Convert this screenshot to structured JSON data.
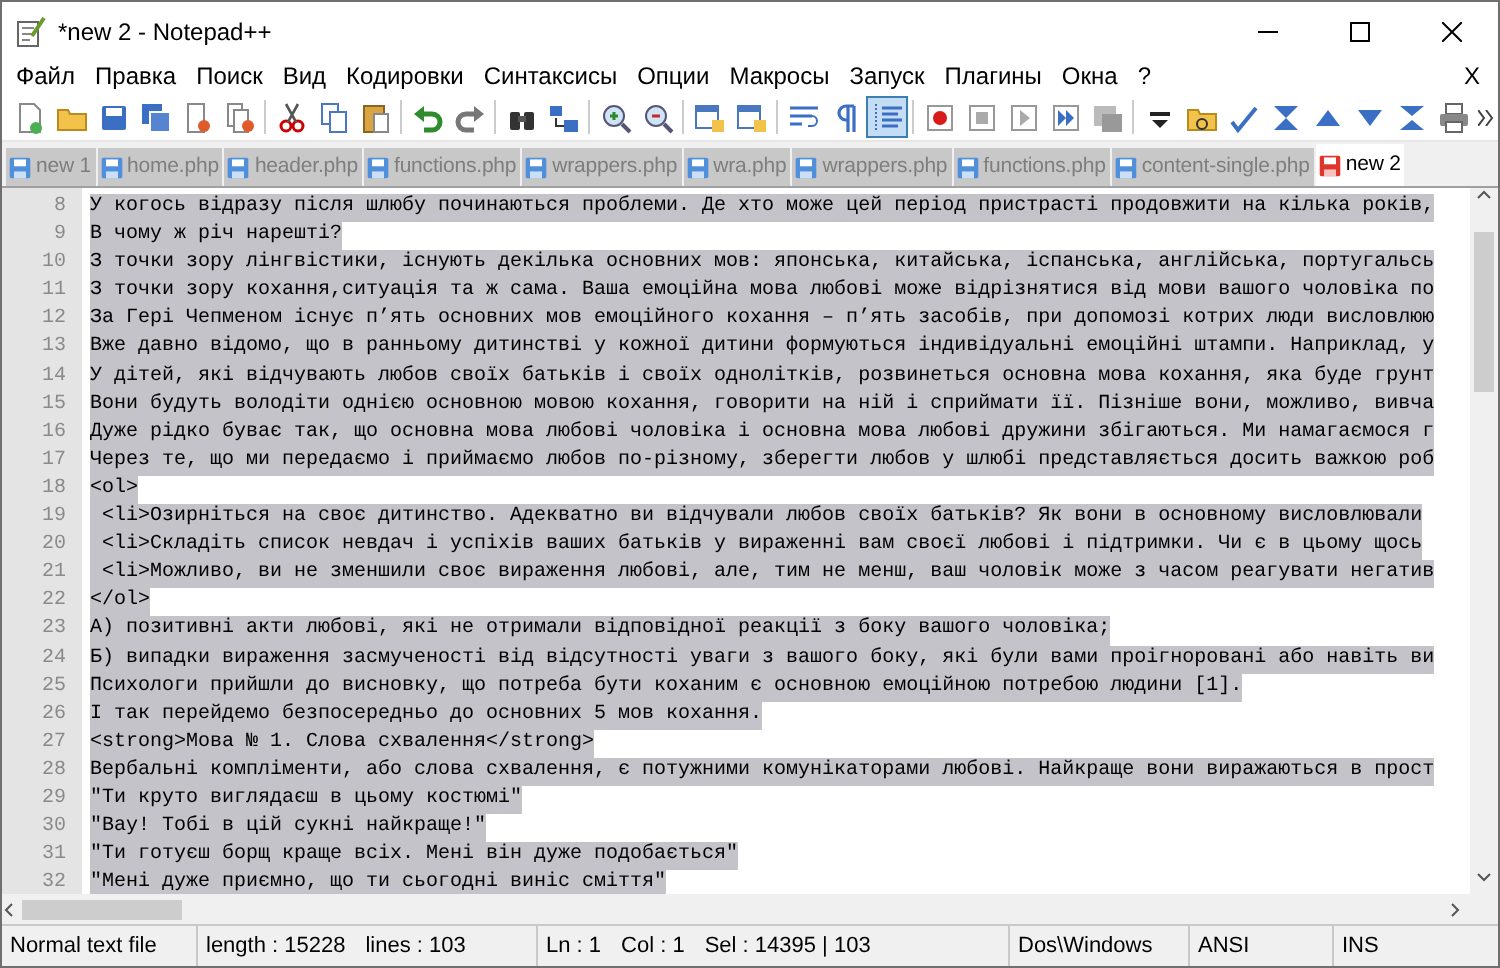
{
  "window": {
    "title": "*new 2 - Notepad++"
  },
  "menu": [
    {
      "label": "Файл"
    },
    {
      "label": "Правка"
    },
    {
      "label": "Поиск"
    },
    {
      "label": "Вид"
    },
    {
      "label": "Кодировки"
    },
    {
      "label": "Синтаксисы"
    },
    {
      "label": "Опции"
    },
    {
      "label": "Макросы"
    },
    {
      "label": "Запуск"
    },
    {
      "label": "Плагины"
    },
    {
      "label": "Окна"
    },
    {
      "label": "?"
    }
  ],
  "menu_close": "X",
  "toolbar": [
    {
      "pressed": false
    },
    {
      "pressed": false
    },
    {
      "pressed": false
    },
    {
      "pressed": false
    },
    {
      "pressed": false
    },
    {
      "pressed": false
    },
    {
      "pressed": false
    },
    {
      "pressed": false
    },
    {
      "pressed": false
    },
    {
      "pressed": false
    },
    {
      "pressed": false
    },
    {
      "pressed": false
    },
    {
      "pressed": false
    },
    {
      "pressed": false
    },
    {
      "pressed": false
    },
    {
      "pressed": false
    },
    {
      "pressed": false
    },
    {
      "pressed": false
    },
    {
      "pressed": false
    },
    {
      "pressed": true
    },
    {
      "pressed": false
    },
    {
      "pressed": false
    },
    {
      "pressed": false
    },
    {
      "pressed": false
    },
    {
      "pressed": false
    },
    {
      "pressed": false
    },
    {
      "pressed": false
    },
    {
      "pressed": false
    },
    {
      "pressed": false
    },
    {
      "pressed": false
    },
    {
      "pressed": false
    },
    {
      "pressed": false
    },
    {
      "pressed": false
    }
  ],
  "tabs": [
    {
      "label": "new 1",
      "selected": false,
      "modified": false
    },
    {
      "label": "home.php",
      "selected": false,
      "modified": false
    },
    {
      "label": "header.php",
      "selected": false,
      "modified": false
    },
    {
      "label": "functions.php",
      "selected": false,
      "modified": false
    },
    {
      "label": "wrappers.php",
      "selected": false,
      "modified": false
    },
    {
      "label": "wra.php",
      "selected": false,
      "modified": false
    },
    {
      "label": "wrappers.php",
      "selected": false,
      "modified": false
    },
    {
      "label": "functions.php",
      "selected": false,
      "modified": false
    },
    {
      "label": "content-single.php",
      "selected": false,
      "modified": false
    },
    {
      "label": "new 2",
      "selected": true,
      "modified": true
    }
  ],
  "editor": {
    "lines": [
      {
        "number": "8",
        "text": "У когось відразу після шлюбу починаються проблеми. Де хто може цей період пристрасті продовжити на кілька років,",
        "selected": true
      },
      {
        "number": "9",
        "text": "В чому ж річ нарешті?",
        "selected": true
      },
      {
        "number": "10",
        "text": "З точки зору лінгвістики, існують декілька основних мов: японська, китайська, іспанська, англійська, португальсь",
        "selected": true
      },
      {
        "number": "11",
        "text": "З точки зору кохання,ситуація та ж сама. Ваша емоційна мова любові може відрізнятися від мови вашого чоловіка по",
        "selected": true
      },
      {
        "number": "12",
        "text": "За Гері Чепменом існує п’ять основних мов емоційного кохання – п’ять засобів, при допомозі котрих люди висловлюю",
        "selected": true
      },
      {
        "number": "13",
        "text": "Вже давно відомо, що в ранньому дитинстві у кожної дитини формуються індивідуальні емоційні штампи. Наприклад, у",
        "selected": true
      },
      {
        "number": "14",
        "text": "У дітей, які відчувають любов своїх батьків і своїх однолітків, розвинеться основна мова кохання, яка буде грунт",
        "selected": true
      },
      {
        "number": "15",
        "text": "Вони будуть володіти однією основною мовою кохання, говорити на ній і сприймати її. Пізніше вони, можливо, вивча",
        "selected": true
      },
      {
        "number": "16",
        "text": "Дуже рідко буває так, що основна мова любові чоловіка і основна мова любові дружини збігаються. Ми намагаємося г",
        "selected": true
      },
      {
        "number": "17",
        "text": "Через те, що ми передаємо і приймаємо любов по-різному, зберегти любов у шлюбі представляється досить важкою роб",
        "selected": true
      },
      {
        "number": "18",
        "text": "<ol>",
        "selected": true
      },
      {
        "number": "19",
        "text": " <li>Озирніться на своє дитинство. Адекватно ви відчували любов своїх батьків? Як вони в основному висловлювали",
        "selected": true
      },
      {
        "number": "20",
        "text": " <li>Складіть список невдач і успіхів ваших батьків у вираженні вам своєї любові і підтримки. Чи є в цьому щось",
        "selected": true
      },
      {
        "number": "21",
        "text": " <li>Можливо, ви не зменшили своє вираження любові, але, тим не менш, ваш чоловік може з часом реагувати негатив",
        "selected": true
      },
      {
        "number": "22",
        "text": "</ol>",
        "selected": true
      },
      {
        "number": "23",
        "text": "А) позитивні акти любові, які не отримали відповідної реакції з боку вашого чоловіка;",
        "selected": true
      },
      {
        "number": "24",
        "text": "Б) випадки вираження засмученості від відсутності уваги з вашого боку, які були вами проігноровані або навіть ви",
        "selected": true
      },
      {
        "number": "25",
        "text": "Психологи прийшли до висновку, що потреба бути коханим є основною емоційною потребою людини [1].",
        "selected": true
      },
      {
        "number": "26",
        "text": "І так перейдемо безпосередньо до основних 5 мов кохання.",
        "selected": true
      },
      {
        "number": "27",
        "text": "<strong>Мова № 1. Слова схвалення</strong>",
        "selected": true
      },
      {
        "number": "28",
        "text": "Вербальні компліменти, або слова схвалення, є потужними комунікаторами любові. Найкраще вони виражаються в прост",
        "selected": true
      },
      {
        "number": "29",
        "text": "\"Ти круто виглядаєш в цьому костюмі\"",
        "selected": true
      },
      {
        "number": "30",
        "text": "\"Вау! Тобі в цій сукні найкраще!\"",
        "selected": true
      },
      {
        "number": "31",
        "text": "\"Ти готуєш борщ краще всіх. Мені він дуже подобається\"",
        "selected": true
      },
      {
        "number": "32",
        "text": "\"Мені дуже приємно, що ти сьогодні виніс сміття\"",
        "selected": true
      }
    ]
  },
  "status_bar": [
    {
      "texts": [
        "Normal text file"
      ]
    },
    {
      "texts": [
        "length : 15228",
        "lines : 103"
      ]
    },
    {
      "texts": [
        "Ln : 1",
        "Col : 1",
        "Sel : 14395 | 103"
      ]
    },
    {
      "texts": [
        "Dos\\Windows"
      ]
    },
    {
      "texts": [
        "ANSI"
      ]
    },
    {
      "texts": [
        "INS"
      ]
    }
  ]
}
